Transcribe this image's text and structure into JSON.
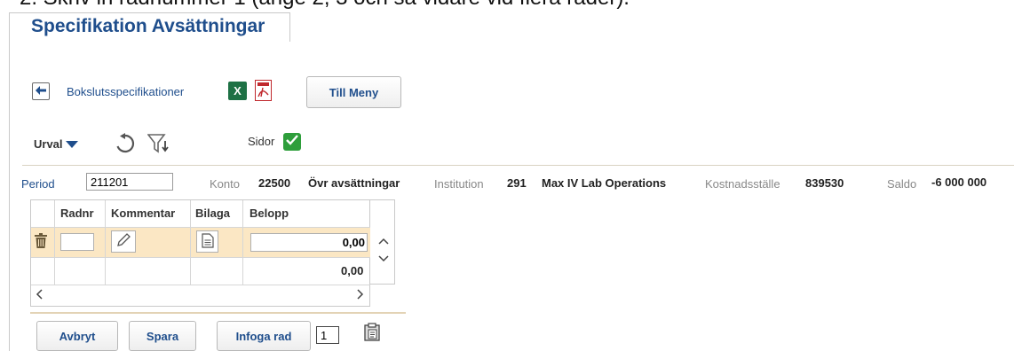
{
  "instruction": {
    "text": "2. Skriv in radnummer 1 (ange 2, 3 och så vidare vid flera rader)."
  },
  "page": {
    "title": "Specifikation Avsättningar"
  },
  "nav": {
    "back_link": "Bokslutsspecifikationer",
    "menu_button": "Till Meny",
    "excel_icon": "excel-icon",
    "pdf_icon": "pdf-icon"
  },
  "toolbar": {
    "urval_label": "Urval",
    "sidor_label": "Sidor",
    "sidor_checked": true
  },
  "info": {
    "period_label": "Period",
    "period_value": "211201",
    "konto_label": "Konto",
    "konto_number": "22500",
    "konto_name": "Övr avsättningar",
    "institution_label": "Institution",
    "institution_number": "291",
    "institution_name": "Max IV Lab Operations",
    "kostnadsstalle_label": "Kostnadsställe",
    "kostnadsstalle_value": "839530",
    "saldo_label": "Saldo",
    "saldo_value": "-6 000 000"
  },
  "grid": {
    "columns": [
      "Radnr",
      "Kommentar",
      "Bilaga",
      "Belopp"
    ],
    "rows": [
      {
        "radnr": "",
        "belopp": "0,00"
      }
    ],
    "total": "0,00"
  },
  "actions": {
    "cancel": "Avbryt",
    "save": "Spara",
    "insert_row": "Infoga rad",
    "insert_count": "1"
  },
  "colors": {
    "title": "#1f4e8c",
    "selected_row": "#fbe7c4",
    "check": "#2e9e3b"
  }
}
